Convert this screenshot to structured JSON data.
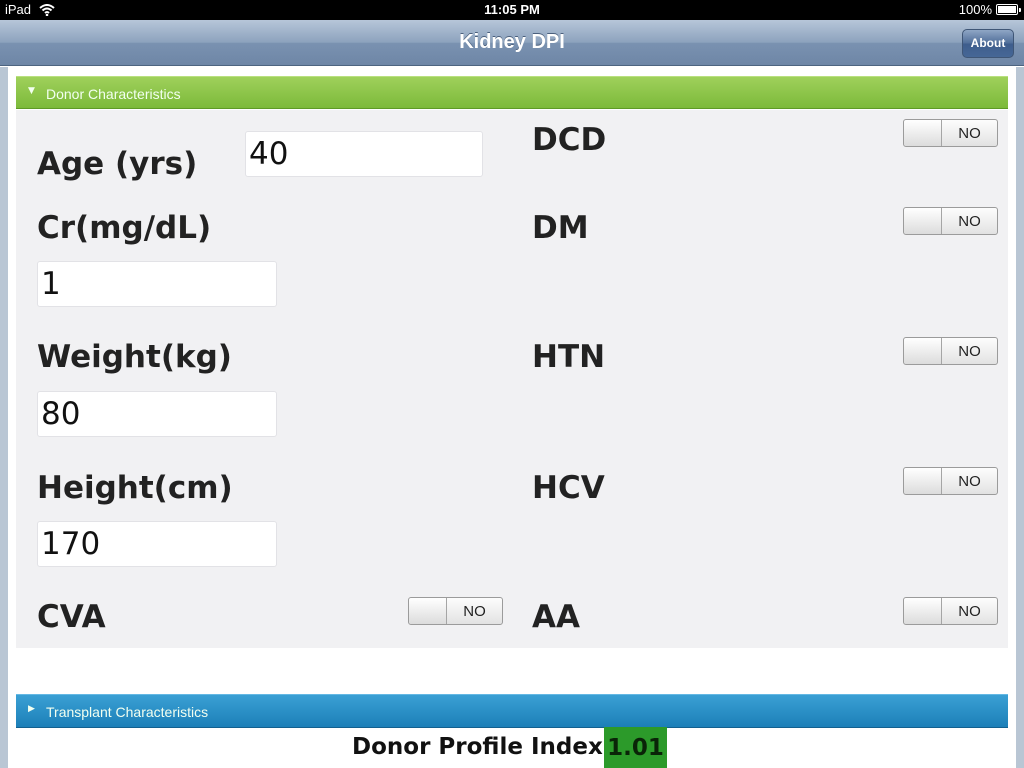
{
  "status_bar": {
    "device": "iPad",
    "time": "11:05 PM",
    "battery": "100%",
    "battery_level": 1.0
  },
  "nav": {
    "title": "Kidney DPI",
    "about_label": "About"
  },
  "sections": {
    "donor": {
      "title": "Donor Characteristics"
    },
    "transplant": {
      "title": "Transplant Characteristics"
    }
  },
  "fields": {
    "age": {
      "label": "Age (yrs)",
      "value": "40"
    },
    "cr": {
      "label": "Cr(mg/dL)",
      "value": "1"
    },
    "weight": {
      "label": "Weight(kg)",
      "value": "80"
    },
    "height": {
      "label": "Height(cm)",
      "value": "170"
    }
  },
  "toggles": {
    "cva": {
      "label": "CVA",
      "state": "NO"
    },
    "dcd": {
      "label": "DCD",
      "state": "NO"
    },
    "dm": {
      "label": "DM",
      "state": "NO"
    },
    "htn": {
      "label": "HTN",
      "state": "NO"
    },
    "hcv": {
      "label": "HCV",
      "state": "NO"
    },
    "aa": {
      "label": "AA",
      "state": "NO"
    }
  },
  "footer": {
    "label": "Donor Profile Index",
    "value": "1.01"
  },
  "colors": {
    "section_donor": "#8cc34a",
    "section_transplant": "#2a8cc5",
    "dpi_value_bg": "#2c9a2a"
  }
}
